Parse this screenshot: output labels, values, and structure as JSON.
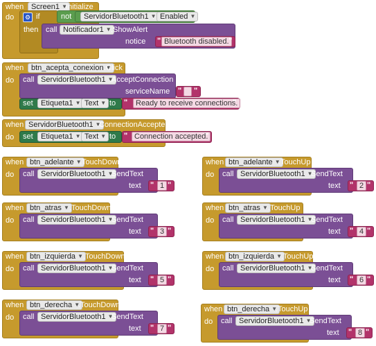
{
  "keywords": {
    "when": "when",
    "do": "do",
    "if": "if",
    "then": "then",
    "call": "call",
    "set": "set",
    "to": "to",
    "not": "not"
  },
  "b1": {
    "component": "Screen1",
    "event": ".Initialize",
    "if_target": "ServidorBluetooth1",
    "if_prop": "Enabled",
    "call_target": "Notificador1",
    "call_method": ".ShowAlert",
    "param": "notice",
    "text": "Bluetooth disabled."
  },
  "b2": {
    "component": "btn_acepta_conexion",
    "event": ".Click",
    "call_target": "ServidorBluetooth1",
    "call_method": ".AcceptConnection",
    "param": "serviceName",
    "param_value": " ",
    "set_target": "Etiqueta1",
    "set_prop": "Text",
    "text": "Ready to receive connections."
  },
  "b3": {
    "component": "ServidorBluetooth1",
    "event": ".ConnectionAccepted",
    "set_target": "Etiqueta1",
    "set_prop": "Text",
    "text": "Connection accepted."
  },
  "sends": [
    {
      "component": "btn_adelante",
      "event": ".TouchDown",
      "target": "ServidorBluetooth1",
      "method": ".SendText",
      "param": "text",
      "value": "1"
    },
    {
      "component": "btn_adelante",
      "event": ".TouchUp",
      "target": "ServidorBluetooth1",
      "method": ".SendText",
      "param": "text",
      "value": "2"
    },
    {
      "component": "btn_atras",
      "event": ".TouchDown",
      "target": "ServidorBluetooth1",
      "method": ".SendText",
      "param": "text",
      "value": "3"
    },
    {
      "component": "btn_atras",
      "event": ".TouchUp",
      "target": "ServidorBluetooth1",
      "method": ".SendText",
      "param": "text",
      "value": "4"
    },
    {
      "component": "btn_izquierda",
      "event": ".TouchDown",
      "target": "ServidorBluetooth1",
      "method": ".SendText",
      "param": "text",
      "value": "5"
    },
    {
      "component": "btn_izquierda",
      "event": ".TouchUp",
      "target": "ServidorBluetooth1",
      "method": ".SendText",
      "param": "text",
      "value": "6"
    },
    {
      "component": "btn_derecha",
      "event": ".TouchDown",
      "target": "ServidorBluetooth1",
      "method": ".SendText",
      "param": "text",
      "value": "7"
    },
    {
      "component": "btn_derecha",
      "event": ".TouchUp",
      "target": "ServidorBluetooth1",
      "method": ".SendText",
      "param": "text",
      "value": "8"
    }
  ],
  "colors": {
    "event": "#c69a2d",
    "procedure": "#7b4f95",
    "control": "#b28a23",
    "logic": "#5b9d4e",
    "setter": "#2f7a4a",
    "text": "#b2336a"
  }
}
